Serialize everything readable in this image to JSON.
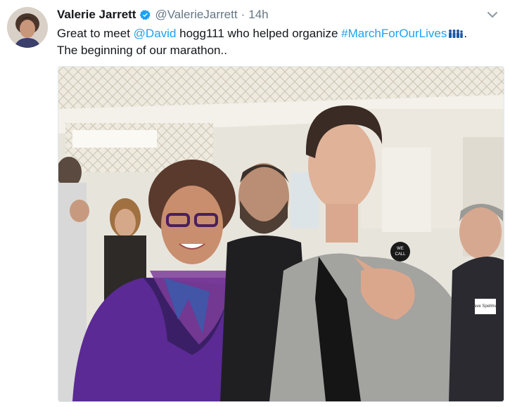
{
  "tweet": {
    "author_name": "Valerie Jarrett",
    "author_handle": "@ValerieJarrett",
    "separator": "·",
    "timestamp": "14h",
    "text_1": "Great to meet ",
    "mention": "@David",
    "text_2": " hogg111 who helped organize ",
    "hashtag": "#MarchForOurLives",
    "text_3": ".",
    "line_2": "The beginning of our marathon..",
    "badge_text": "WE CALL",
    "name_tag_text": "Dave Spellman"
  },
  "colors": {
    "link": "#1da1f2",
    "verified": "#1da1f2",
    "muted": "#657786"
  },
  "icons": {
    "verified": "verified-badge-icon",
    "menu": "chevron-down-icon",
    "hashflag": "family-hashflag-icon"
  }
}
